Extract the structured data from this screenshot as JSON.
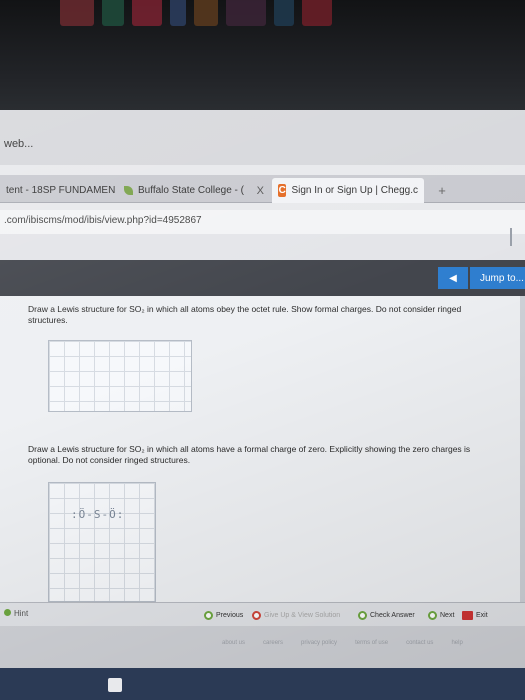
{
  "window": {
    "title": "web..."
  },
  "tabs": [
    {
      "label": "tent - 18SP FUNDAMEN",
      "icon": "none"
    },
    {
      "label": "Buffalo State College - (",
      "icon": "leaf-icon"
    },
    {
      "label": "Sign In or Sign Up | Chegg.c",
      "icon": "chegg-icon",
      "badge": "C"
    }
  ],
  "new_tab_glyph": "+",
  "close_glyph": "X",
  "address_bar": {
    "url": ".com/ibiscms/mod/ibis/view.php?id=4952867"
  },
  "navigation": {
    "prev_glyph": "◀",
    "jump_label": "Jump to..."
  },
  "questions": [
    {
      "text": "Draw a Lewis structure for SO₂ in which all atoms obey the octet rule. Show formal charges. Do not consider ringed structures."
    },
    {
      "text": "Draw a Lewis structure for SO₂ in which all atoms have a formal charge of zero. Explicitly showing the zero charges is optional. Do not consider ringed structures.",
      "sketch": ":Ö-S-Ö:"
    }
  ],
  "bottom_bar": {
    "hint": "Hint",
    "previous": "Previous",
    "give_up": "Give Up & View Solution",
    "check_answer": "Check Answer",
    "next": "Next",
    "exit": "Exit"
  },
  "footer": {
    "links": [
      "about us",
      "careers",
      "privacy policy",
      "terms of use",
      "contact us",
      "help"
    ]
  },
  "colors": {
    "nav_band": "#43464d",
    "nav_button": "#2f7fd0",
    "chegg_orange": "#e46a22"
  }
}
